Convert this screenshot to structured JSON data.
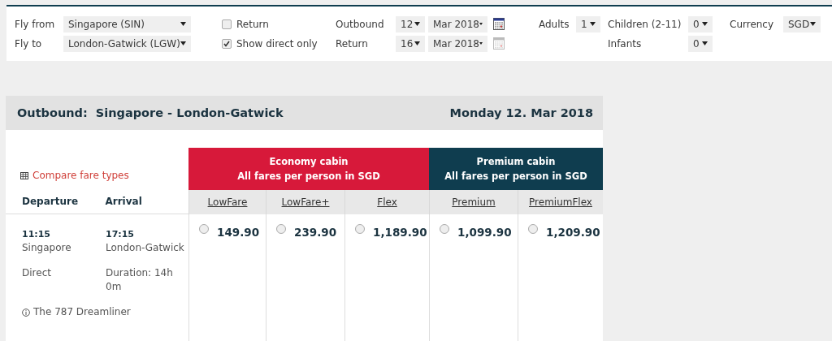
{
  "search": {
    "fly_from": {
      "label": "Fly from",
      "value": "Singapore (SIN)"
    },
    "fly_to": {
      "label": "Fly to",
      "value": "London-Gatwick (LGW)"
    },
    "options": [
      {
        "label": "Return",
        "checked": false
      },
      {
        "label": "Show direct only",
        "checked": true
      }
    ],
    "dates": [
      {
        "label": "Outbound",
        "day": "12",
        "month": "Mar 2018",
        "disabled": false
      },
      {
        "label": "Return",
        "day": "16",
        "month": "Mar 2018",
        "disabled": true
      }
    ],
    "adults": {
      "label": "Adults",
      "value": "1"
    },
    "children": {
      "label": "Children (2-11)",
      "value": "0"
    },
    "infants": {
      "label": "Infants",
      "value": "0"
    },
    "currency": {
      "label": "Currency",
      "value": "SGD"
    }
  },
  "journey": {
    "title": "Outbound:  Singapore - London-Gatwick",
    "date": "Monday 12. Mar 2018",
    "compare_link": "Compare fare types",
    "departure_heading": "Departure",
    "arrival_heading": "Arrival",
    "cabins": [
      {
        "name": "Economy cabin",
        "note": "All fares per person in SGD",
        "color": "#d7193a",
        "fares": [
          "LowFare",
          "LowFare+",
          "Flex"
        ]
      },
      {
        "name": "Premium cabin",
        "note": "All fares per person in SGD",
        "color": "#0f3d4f",
        "fares": [
          "Premium",
          "PremiumFlex"
        ]
      }
    ],
    "flights": [
      {
        "departure_time": "11:15",
        "departure_place": "Singapore",
        "arrival_time": "17:15",
        "arrival_place": "London-Gatwick",
        "stops": "Direct",
        "duration": "Duration: 14h 0m",
        "aircraft": "The 787 Dreamliner",
        "prices": [
          {
            "amount": "149.90",
            "selected": false
          },
          {
            "amount": "239.90",
            "selected": false
          },
          {
            "amount": "1,189.90",
            "selected": false
          },
          {
            "amount": "1,099.90",
            "selected": false
          },
          {
            "amount": "1,209.90",
            "selected": false
          }
        ]
      }
    ]
  }
}
